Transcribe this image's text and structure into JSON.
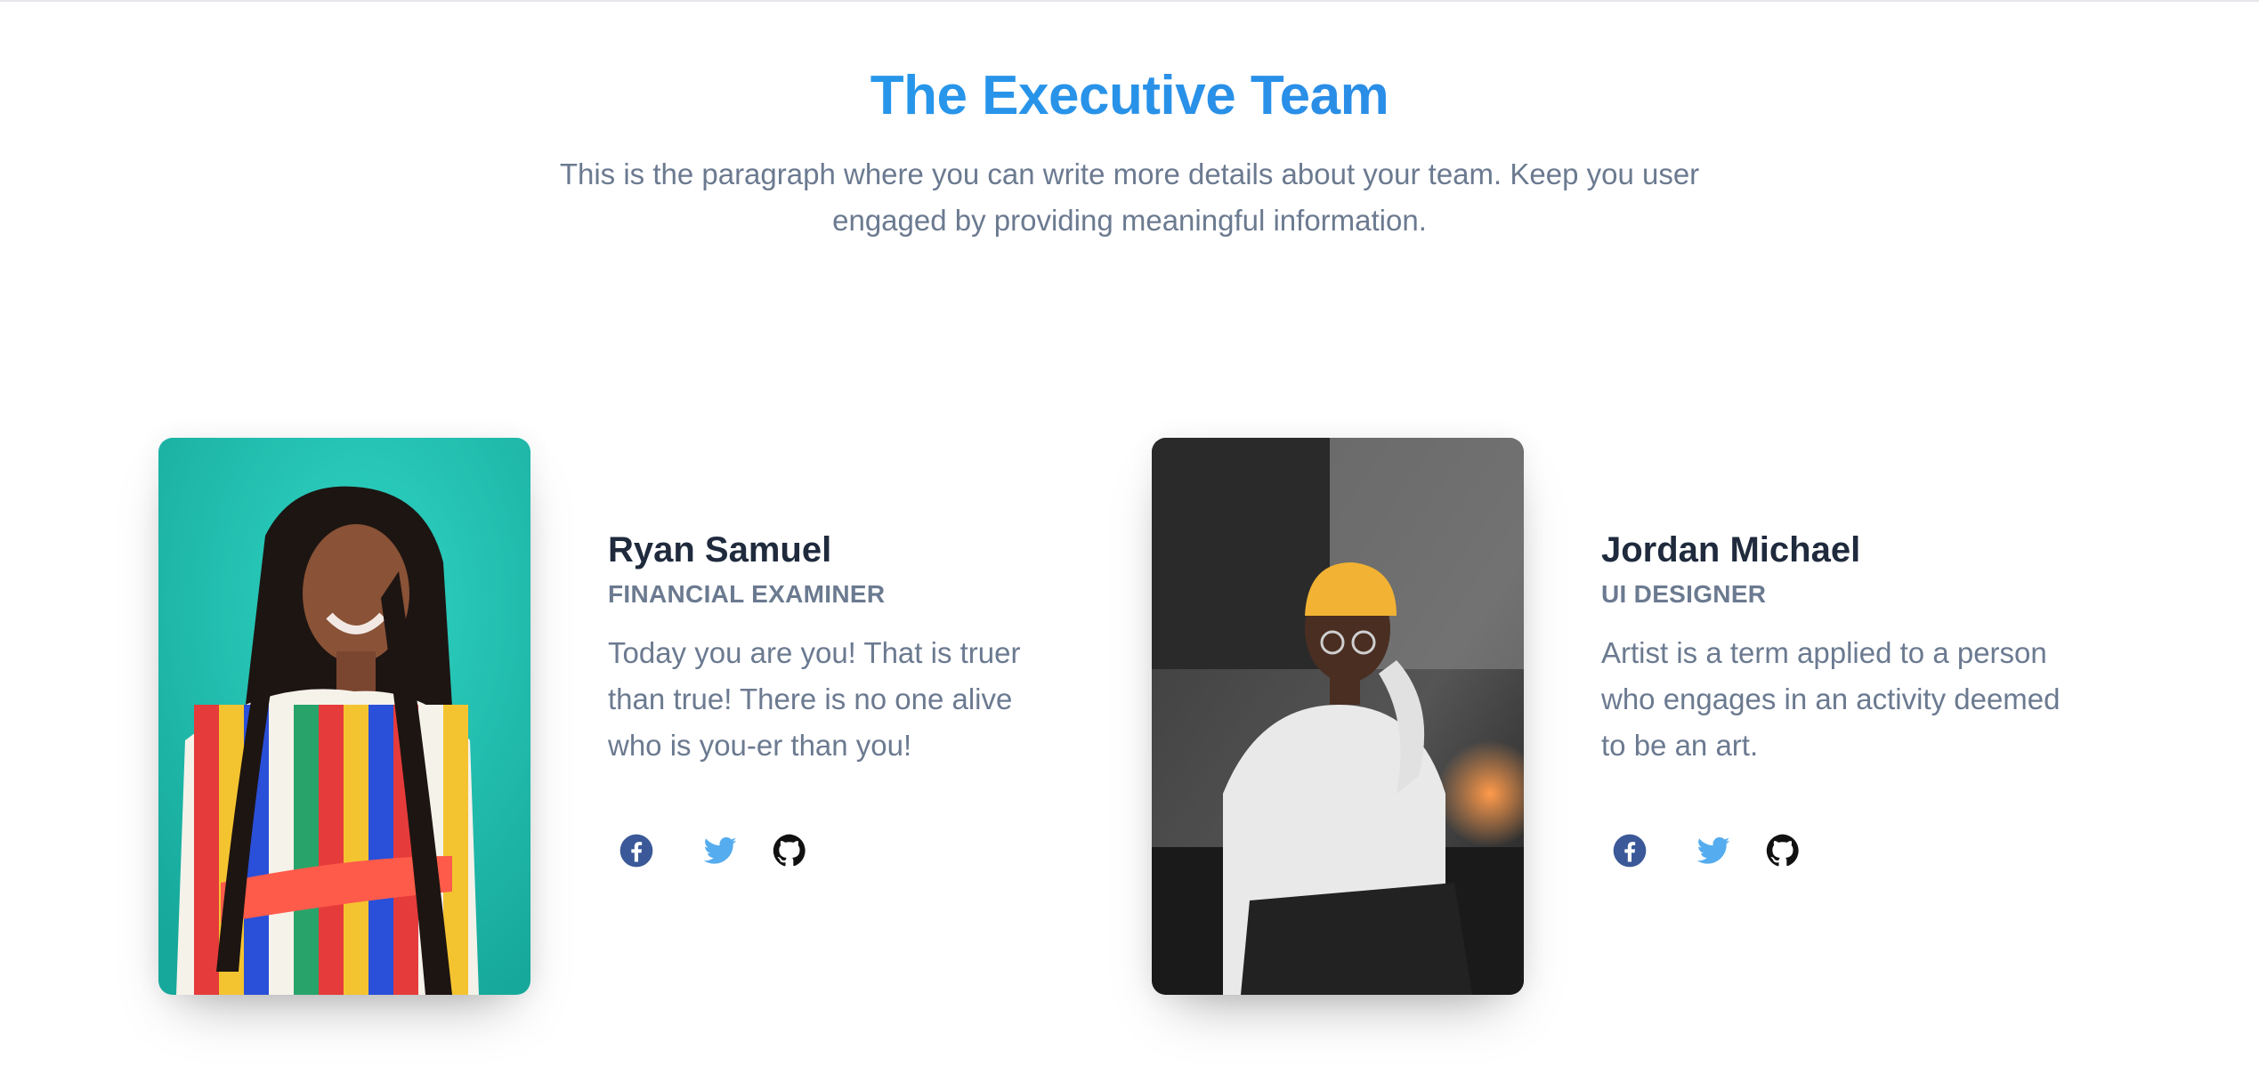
{
  "header": {
    "title": "The Executive Team",
    "subtitle": "This is the paragraph where you can write more details about your team. Keep you user engaged by providing meaningful information."
  },
  "members": [
    {
      "name": "Ryan Samuel",
      "role": "FINANCIAL EXAMINER",
      "bio": "Today you are you! That is truer than true! There is no one alive who is you-er than you!",
      "photo_icon": "portrait-photo-woman",
      "social": [
        "facebook-icon",
        "twitter-icon",
        "github-icon"
      ]
    },
    {
      "name": "Jordan Michael",
      "role": "UI DESIGNER",
      "bio": "Artist is a term applied to a person who engages in an activity deemed to be an art.",
      "photo_icon": "portrait-photo-man",
      "social": [
        "facebook-icon",
        "twitter-icon",
        "github-icon"
      ]
    }
  ],
  "colors": {
    "title_gradient_start": "#22a7f0",
    "title_gradient_end": "#2f7de1",
    "text_muted": "#6b7a90",
    "text_dark": "#1f2a3d",
    "facebook": "#3b5998",
    "twitter": "#55acee",
    "github": "#111111"
  }
}
